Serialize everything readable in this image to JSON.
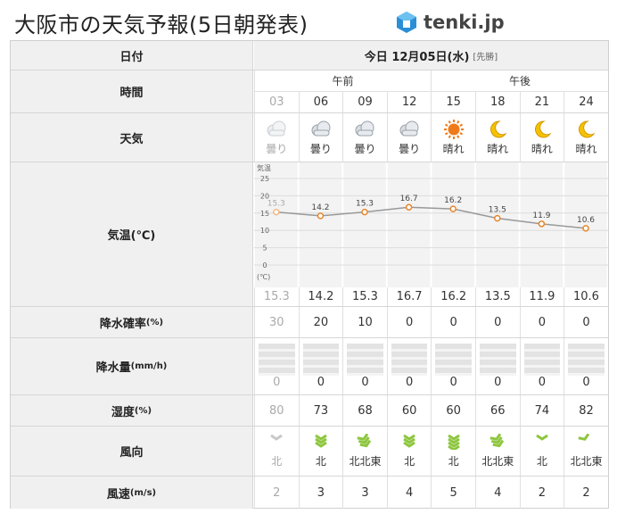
{
  "page": {
    "title": "大阪市の天気予報(5日朝発表)",
    "logo_text": "tenki.jp"
  },
  "header": {
    "label": "日付",
    "date": "今日 12月05日(水)",
    "tag": "[先勝]"
  },
  "rows": {
    "time": "時間",
    "weather": "天気",
    "temp": "気温(℃)",
    "precip_prob": "降水確率",
    "precip_prob_unit": "(%)",
    "precip_amt": "降水量",
    "precip_amt_unit": "(mm/h)",
    "humidity": "湿度",
    "humidity_unit": "(%)",
    "wind_dir": "風向",
    "wind_speed": "風速",
    "wind_speed_unit": "(m/s)"
  },
  "periods": {
    "am": "午前",
    "pm": "午後"
  },
  "hours": [
    "03",
    "06",
    "09",
    "12",
    "15",
    "18",
    "21",
    "24"
  ],
  "weather": [
    {
      "icon": "cloud-icon",
      "label": "曇り"
    },
    {
      "icon": "cloud-icon",
      "label": "曇り"
    },
    {
      "icon": "cloud-icon",
      "label": "曇り"
    },
    {
      "icon": "cloud-icon",
      "label": "曇り"
    },
    {
      "icon": "sun-icon",
      "label": "晴れ"
    },
    {
      "icon": "moon-icon",
      "label": "晴れ"
    },
    {
      "icon": "moon-icon",
      "label": "晴れ"
    },
    {
      "icon": "moon-icon",
      "label": "晴れ"
    }
  ],
  "temps_text": [
    "15.3",
    "14.2",
    "15.3",
    "16.7",
    "16.2",
    "13.5",
    "11.9",
    "10.6"
  ],
  "precip_prob": [
    "30",
    "20",
    "10",
    "0",
    "0",
    "0",
    "0",
    "0"
  ],
  "precip_amt": [
    "0",
    "0",
    "0",
    "0",
    "0",
    "0",
    "0",
    "0"
  ],
  "humidity": [
    "80",
    "73",
    "68",
    "60",
    "60",
    "66",
    "74",
    "82"
  ],
  "wind_dir": [
    "北",
    "北",
    "北北東",
    "北",
    "北",
    "北北東",
    "北",
    "北北東"
  ],
  "wind_strength": [
    1,
    3,
    3,
    3,
    4,
    3,
    1,
    1
  ],
  "wind_speed": [
    "2",
    "3",
    "3",
    "4",
    "5",
    "4",
    "2",
    "2"
  ],
  "colors": {
    "accent": "#e8862a",
    "line": "#999999",
    "wind": "#8dc63f",
    "sun": "#f07a1a",
    "moon": "#f5c200"
  },
  "chart_data": {
    "type": "line",
    "title": "",
    "ylabel": "気温",
    "yunit": "(℃)",
    "x": [
      "03",
      "06",
      "09",
      "12",
      "15",
      "18",
      "21",
      "24"
    ],
    "values": [
      15.3,
      14.2,
      15.3,
      16.7,
      16.2,
      13.5,
      11.9,
      10.6
    ],
    "ylim": [
      0,
      25
    ],
    "yticks": [
      "25",
      "20",
      "15",
      "10",
      "5",
      "0"
    ],
    "grid": true
  }
}
